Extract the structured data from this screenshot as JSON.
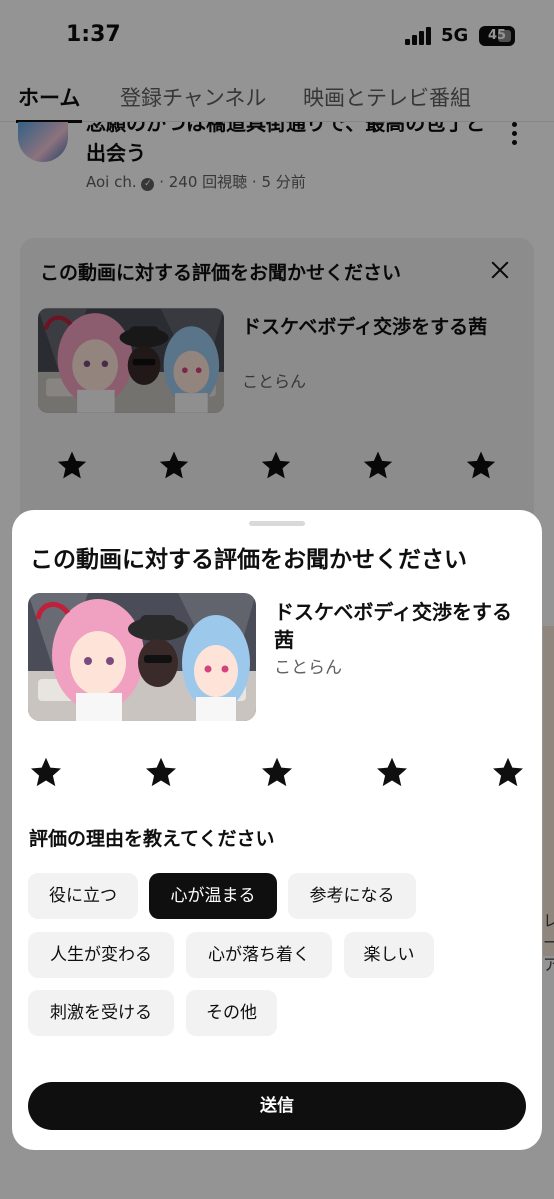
{
  "status_bar": {
    "time": "1:37",
    "network": "5G",
    "battery": "45"
  },
  "tabs": [
    {
      "label": "ホーム",
      "active": true
    },
    {
      "label": "登録チャンネル",
      "active": false
    },
    {
      "label": "映画とテレビ番組",
      "active": false
    }
  ],
  "background_video": {
    "title": "念願のかつは橋道具街通りで、最高の包丁と出会う",
    "channel": "Aoi ch.",
    "meta": "· 240 回視聴 · 5 分前"
  },
  "background_card": {
    "title": "この動画に対する評価をお聞かせください",
    "video_title": "ドスケベボディ交渉をする茜",
    "channel": "ことらん"
  },
  "background_side_text": "レ\nー\nア",
  "sheet": {
    "title": "この動画に対する評価をお聞かせください",
    "video_title": "ドスケベボディ交渉をする茜",
    "channel": "ことらん",
    "star_count": 5,
    "reason_title": "評価の理由を教えてください",
    "reasons": [
      {
        "label": "役に立つ",
        "selected": false
      },
      {
        "label": "心が温まる",
        "selected": true
      },
      {
        "label": "参考になる",
        "selected": false
      },
      {
        "label": "人生が変わる",
        "selected": false
      },
      {
        "label": "心が落ち着く",
        "selected": false
      },
      {
        "label": "楽しい",
        "selected": false
      },
      {
        "label": "刺激を受ける",
        "selected": false
      },
      {
        "label": "その他",
        "selected": false
      }
    ],
    "submit_label": "送信"
  },
  "colors": {
    "accent": "#0f0f0f",
    "chip_bg": "#f2f2f2",
    "overlay": "rgba(0,0,0,0.42)"
  }
}
